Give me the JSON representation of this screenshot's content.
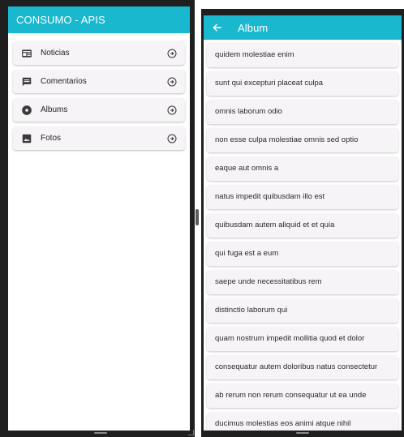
{
  "left_app": {
    "title": "CONSUMO - APIS",
    "appbar_color": "#1ab8cf",
    "menu": [
      {
        "label": "Noticias",
        "icon": "news-icon"
      },
      {
        "label": "Comentarios",
        "icon": "comment-icon"
      },
      {
        "label": "Albums",
        "icon": "album-icon"
      },
      {
        "label": "Fotos",
        "icon": "photo-icon"
      }
    ],
    "trailing_icon": "arrow-circle-right-icon"
  },
  "right_app": {
    "title": "Album",
    "back_icon": "back-arrow-icon",
    "albums": [
      "quidem molestiae enim",
      "sunt qui excepturi placeat culpa",
      "omnis laborum odio",
      "non esse culpa molestiae omnis sed optio",
      "eaque aut omnis a",
      "natus impedit quibusdam illo est",
      "quibusdam autem aliquid et et quia",
      "qui fuga est a eum",
      "saepe unde necessitatibus rem",
      "distinctio laborum qui",
      "quam nostrum impedit mollitia quod et dolor",
      "consequatur autem doloribus natus consectetur",
      "ab rerum non rerum consequatur ut ea unde",
      "ducimus molestias eos animi atque nihil"
    ]
  }
}
